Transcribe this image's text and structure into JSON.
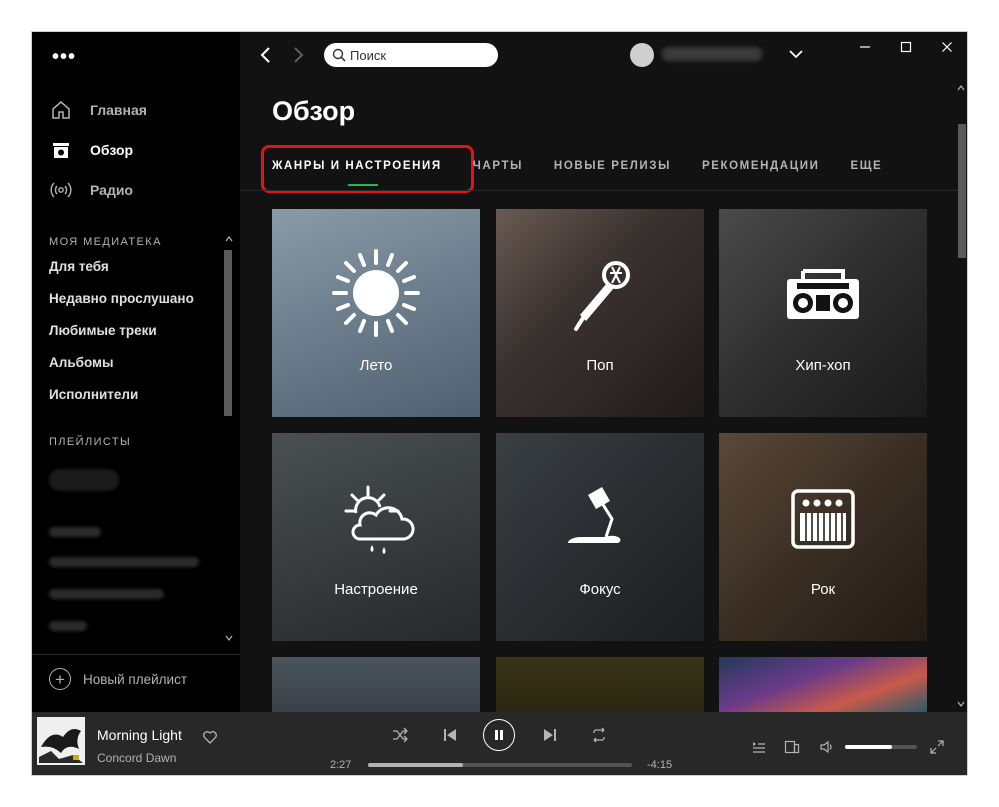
{
  "sidebar": {
    "menu_label": "•••",
    "nav": [
      {
        "label": "Главная",
        "icon": "home-icon",
        "active": false
      },
      {
        "label": "Обзор",
        "icon": "browse-icon",
        "active": true
      },
      {
        "label": "Радио",
        "icon": "radio-icon",
        "active": false
      }
    ],
    "library_title": "МОЯ МЕДИАТЕКА",
    "library": [
      "Для тебя",
      "Недавно прослушано",
      "Любимые треки",
      "Альбомы",
      "Исполнители"
    ],
    "playlists_title": "ПЛЕЙЛИСТЫ",
    "new_playlist": "Новый плейлист"
  },
  "topbar": {
    "search_placeholder": "Поиск"
  },
  "main": {
    "title": "Обзор",
    "tabs": [
      {
        "label": "ЖАНРЫ И НАСТРОЕНИЯ",
        "active": true
      },
      {
        "label": "ЧАРТЫ",
        "active": false
      },
      {
        "label": "НОВЫЕ РЕЛИЗЫ",
        "active": false
      },
      {
        "label": "РЕКОМЕНДАЦИИ",
        "active": false
      },
      {
        "label": "ЕЩЕ",
        "active": false
      }
    ],
    "tiles": [
      {
        "label": "Лето",
        "icon": "sun-icon"
      },
      {
        "label": "Поп",
        "icon": "microphone-icon"
      },
      {
        "label": "Хип-хоп",
        "icon": "boombox-icon"
      },
      {
        "label": "Настроение",
        "icon": "weather-icon"
      },
      {
        "label": "Фокус",
        "icon": "desk-lamp-icon"
      },
      {
        "label": "Рок",
        "icon": "amplifier-icon"
      }
    ]
  },
  "player": {
    "track": "Morning Light",
    "artist": "Concord Dawn",
    "elapsed": "2:27",
    "remaining": "-4:15",
    "progress_fraction": 0.36,
    "volume_fraction": 0.65
  },
  "colors": {
    "accent": "#1db954",
    "highlight_box": "#e0141a"
  }
}
